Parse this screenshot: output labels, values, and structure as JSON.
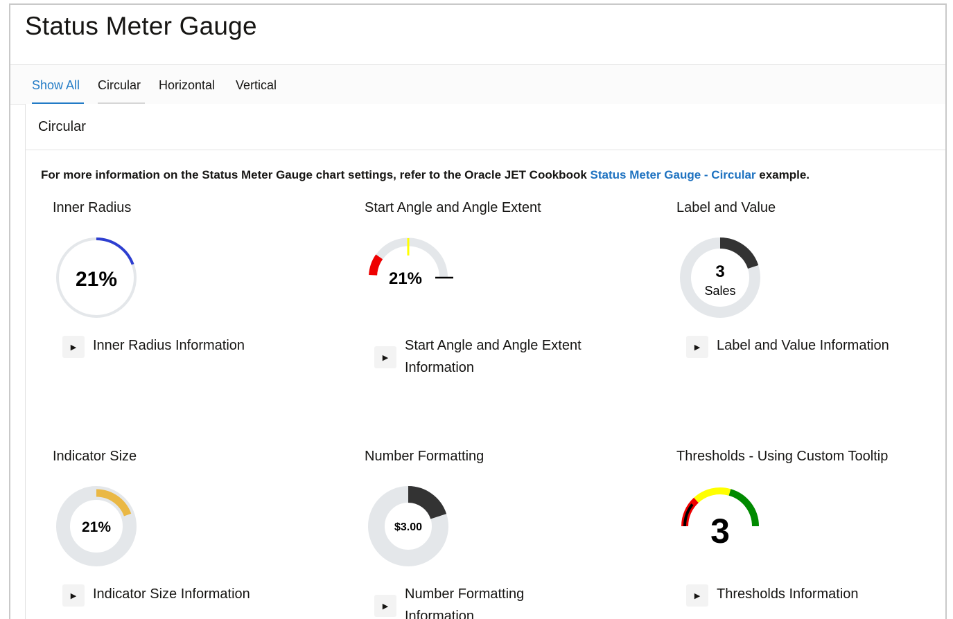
{
  "header": {
    "title": "Status Meter Gauge"
  },
  "tabs": [
    {
      "label": "Show All",
      "active": true
    },
    {
      "label": "Circular",
      "active": false
    },
    {
      "label": "Horizontal",
      "active": false
    },
    {
      "label": "Vertical",
      "active": false
    }
  ],
  "panel": {
    "title": "Circular",
    "info": {
      "prefix": "For more information on the Status Meter Gauge chart settings, refer to the Oracle JET Cookbook ",
      "link": "Status Meter Gauge - Circular",
      "suffix": " example."
    }
  },
  "cards": [
    {
      "title": "Inner Radius",
      "gauge_label": "21%",
      "value_percent": 21,
      "disclosure": "Inner Radius Information"
    },
    {
      "title": "Start Angle and Angle Extent",
      "gauge_label": "21%",
      "value_percent": 21,
      "disclosure_line1": "Start Angle and Angle Extent",
      "disclosure_line2": "Information"
    },
    {
      "title": "Label and Value",
      "gauge_value": "3",
      "gauge_sublabel": "Sales",
      "value": 3,
      "max": 20,
      "disclosure": "Label and Value Information"
    },
    {
      "title": "Indicator Size",
      "gauge_label": "21%",
      "value_percent": 21,
      "disclosure": "Indicator Size Information"
    },
    {
      "title": "Number Formatting",
      "gauge_label": "$3.00",
      "value": 3,
      "max": 15,
      "disclosure_line1": "Number Formatting",
      "disclosure_line2": "Information"
    },
    {
      "title": "Thresholds - Using Custom Tooltip",
      "gauge_value": "3",
      "value": 3,
      "disclosure": "Thresholds Information"
    }
  ],
  "colors": {
    "accent": "#227bc6",
    "link": "#1e72c0",
    "track": "#e4e7ea",
    "blue_indicator": "#2d3ed0",
    "dark_indicator": "#333333",
    "amber_indicator": "#eab845",
    "red": "#ee0000",
    "yellow": "#ffff00",
    "green": "#008a00"
  },
  "icons": {
    "disclosure": "triangle-right-icon"
  }
}
